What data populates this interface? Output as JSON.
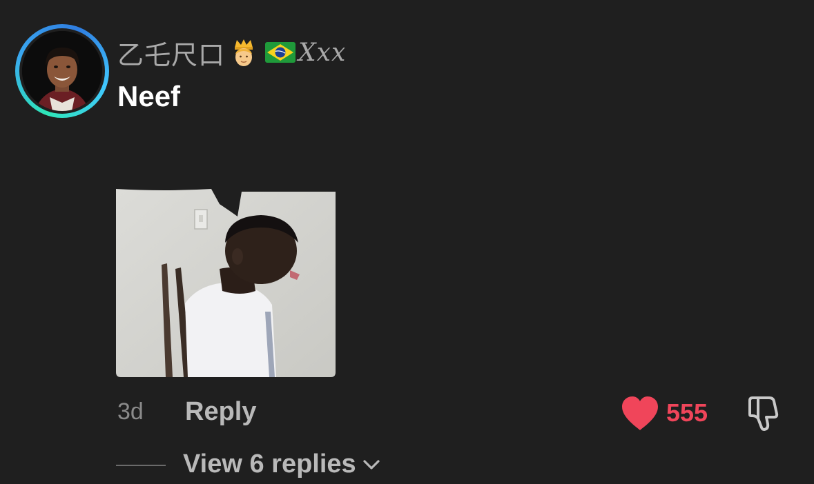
{
  "comment": {
    "username_prefix": "乙乇尺口",
    "username_badge_icon": "prince-emoji-icon",
    "username_flag_icon": "brazil-flag-icon",
    "username_suffix": "Xxx",
    "text": "Neef",
    "media_description_icon": "reaction-gif-image",
    "timestamp": "3d",
    "reply_label": "Reply",
    "like_count": "555",
    "like_color": "#f0455a",
    "view_replies_label": "View 6 replies"
  },
  "colors": {
    "background": "#1f1f1f",
    "ring_start": "#2ee6b8",
    "ring_end": "#3aa8f0"
  }
}
